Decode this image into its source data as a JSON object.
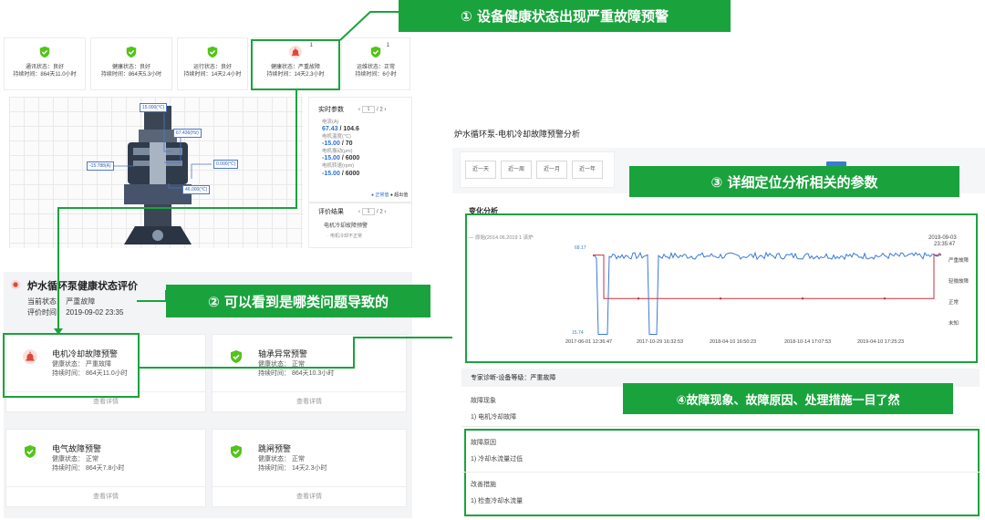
{
  "colors": {
    "accent_green": "#1aa33d",
    "ok_green": "#52c41a",
    "alarm_red": "#e0453a",
    "line_blue": "#3a7bd5",
    "line_red": "#c8323a"
  },
  "status_cards": [
    {
      "label": "通讯状态：良好",
      "duration": "持续时间：864天11.0小时",
      "icon": "shield-check-icon"
    },
    {
      "label": "健康状态：良好",
      "duration": "持续时间：864天5.3小时",
      "icon": "shield-check-icon"
    },
    {
      "label": "运行状态：良好",
      "duration": "持续时间：14天2.4小时",
      "icon": "shield-check-icon"
    },
    {
      "label": "健康状态：严重故障",
      "duration": "持续时间：14天2.3小时",
      "icon": "alarm-siren-icon",
      "sup": "1"
    },
    {
      "label": "运维状态：正常",
      "duration": "持续时间：6小时",
      "icon": "shield-check-icon",
      "sup": "1"
    }
  ],
  "diagram_tags": [
    "15.000(℃)",
    "67.436(Hz)",
    "-15.788(A)",
    "0.000(℃)",
    "46.000(℃)"
  ],
  "realtime_panel": {
    "title": "实时参数",
    "page_current": "1",
    "page_total": "/ 2",
    "params": [
      {
        "name": "电流(A)",
        "value": "67.43",
        "limit": "/ 104.6"
      },
      {
        "name": "电机温度(℃)",
        "value": "-15.00",
        "limit": "/ 70"
      },
      {
        "name": "电机振动(μm)",
        "value": "-15.00",
        "limit": "/ 6000"
      },
      {
        "name": "电机转速(rpm)",
        "value": "-15.00",
        "limit": "/ 6000"
      }
    ],
    "legend": [
      "● 正常值",
      "● 超出值"
    ]
  },
  "eval_panel": {
    "title": "评价结果",
    "page_current": "1",
    "page_total": "/ 2",
    "item": "电机冷却故障预警",
    "subitem": "· 电机冷却不正常"
  },
  "health_eval": {
    "title": "炉水循环泵健康状态评价",
    "state_label": "当前状态：",
    "state_value": "严重故障",
    "time_label": "评价时间：",
    "time_value": "2019-09-02 23:35"
  },
  "health_cards": [
    {
      "title": "电机冷却故障预警",
      "status": "健康状态：  严重故障",
      "duration": "持续时间：  864天11.0小时",
      "icon": "alarm-siren-icon",
      "detail": "查看详情"
    },
    {
      "title": "轴承异常预警",
      "status": "健康状态：  正常",
      "duration": "持续时间：  864天10.3小时",
      "icon": "shield-check-icon",
      "detail": "查看详情"
    },
    {
      "title": "电气故障预警",
      "status": "健康状态：  正常",
      "duration": "持续时间：  864天7.8小时",
      "icon": "shield-check-icon",
      "detail": "查看详情"
    },
    {
      "title": "跳闸预警",
      "status": "健康状态：  正常",
      "duration": "持续时间：  14天2.3小时",
      "icon": "shield-check-icon",
      "detail": "查看详情"
    }
  ],
  "callouts": {
    "c1": "① 设备健康状态出现严重故障预警",
    "c2": "② 可以看到是哪类问题导致的",
    "c3": "③ 详细定位分析相关的参数",
    "c4": "④故障现象、故障原因、处理措施一目了然"
  },
  "analysis": {
    "title": "炉水循环泵-电机冷却故障预警分析",
    "tabs": [
      "近一天",
      "近一周",
      "近一月",
      "近一年"
    ],
    "section": "变化分析",
    "legend_text": "— 原始(2014.06.2019 1 该炉",
    "y_top": "68.17",
    "y_bottom": "15.74",
    "top_right_date": "2019-09-03",
    "top_right_time": "23:35:47",
    "right_labels": [
      "严重故障",
      "轻微故障",
      "正常",
      "未知"
    ],
    "x_ticks": [
      "2017-06-01 12:36:47",
      "2017-10-29 16:32:53",
      "2018-04-10 16:50:23",
      "2018-10-14 17:07:53",
      "2019-04-10 17:25:23"
    ]
  },
  "chart_data": {
    "type": "line",
    "title": "",
    "x": [
      "2017-06-01 12:36:47",
      "2017-10-29 16:32:53",
      "2018-04-10 16:50:23",
      "2018-10-14 17:07:53",
      "2019-04-10 17:25:23",
      "2019-09-03 23:35:47"
    ],
    "ylim": [
      15.74,
      68.17
    ],
    "series": [
      {
        "name": "",
        "color": "#3a7bd5",
        "values": [
          63.5,
          64.0,
          63.7,
          64.1,
          63.6,
          64.5
        ],
        "note_dips": "two drops to ~16 near 2017-06 and 2017-09"
      },
      {
        "name": "",
        "color": "#c8323a",
        "values": [
          64.0,
          38.0,
          38.0,
          38.0,
          38.0,
          64.0
        ]
      }
    ],
    "grid": false,
    "legend": "top-left"
  },
  "diagnosis": {
    "header": "专家诊断-设备等级：严重故障",
    "sections": [
      {
        "title": "故障现象",
        "item": "1)  电机冷却故障"
      },
      {
        "title": "故障原因",
        "item": "1)  冷却水流量过低"
      },
      {
        "title": "改善措施",
        "item": "1)  检查冷却水流量"
      }
    ]
  }
}
